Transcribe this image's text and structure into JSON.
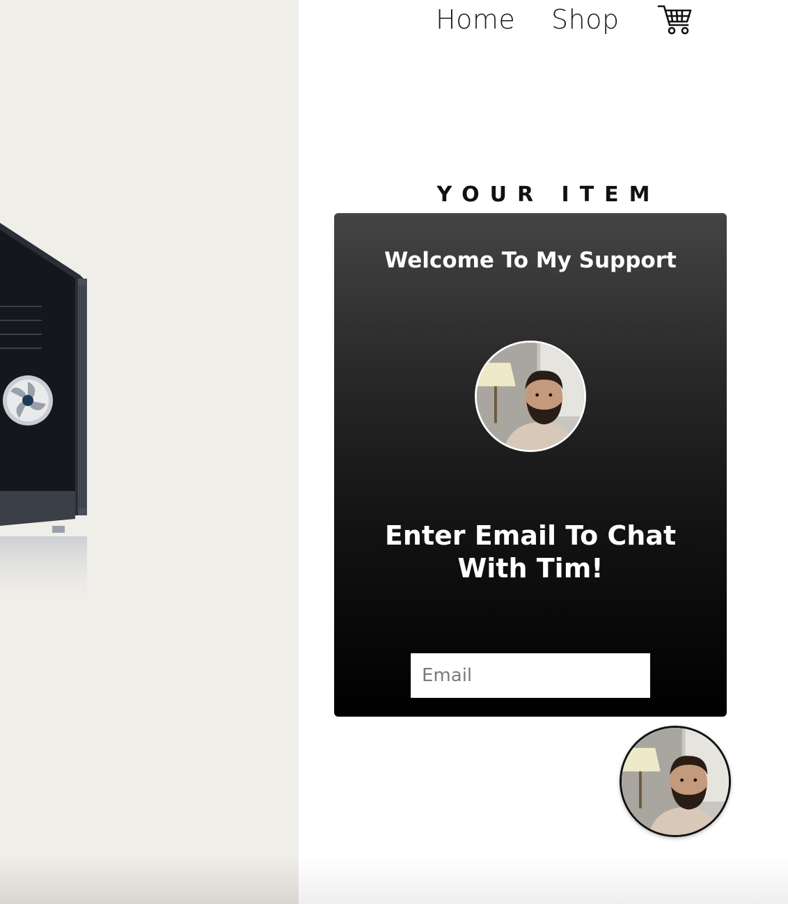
{
  "nav": {
    "home_label": "Home",
    "shop_label": "Shop",
    "cart_icon": "shopping-cart-icon"
  },
  "section": {
    "heading": "YOUR ITEM"
  },
  "support_card": {
    "title": "Welcome To My Support",
    "prompt": "Enter Email To Chat With Tim!",
    "email_placeholder": "Email",
    "email_value": ""
  },
  "colors": {
    "left_panel_bg": "#f0eee9",
    "card_top": "#444444",
    "card_bottom": "#000000",
    "text_on_card": "#ffffff"
  }
}
